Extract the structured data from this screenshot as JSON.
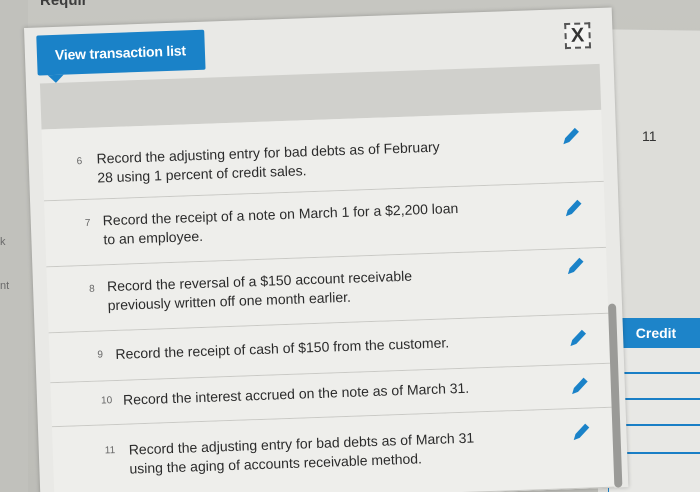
{
  "background": {
    "heading_fragment": "Requir",
    "left_fragments": [
      "k",
      "nt"
    ],
    "right_panel": {
      "number": "11",
      "credit_label": "Credit"
    }
  },
  "modal": {
    "title": "View transaction list",
    "close_label": "X",
    "transactions": [
      {
        "number": "6",
        "text": [
          "Record the adjusting entry for bad debts as of February",
          "28 using 1 percent of credit sales."
        ]
      },
      {
        "number": "7",
        "text": [
          "Record the receipt of a note on March 1 for a $2,200 loan",
          "to an employee."
        ]
      },
      {
        "number": "8",
        "text": [
          "Record the reversal of a $150 account receivable",
          "previously written off one month earlier."
        ]
      },
      {
        "number": "9",
        "text": [
          "Record the receipt of cash of $150 from the customer."
        ]
      },
      {
        "number": "10",
        "text": [
          "Record the interest accrued on the note as of March 31."
        ]
      },
      {
        "number": "11",
        "text": [
          "Record the adjusting entry for bad debts as of March 31",
          "using the aging of accounts receivable method."
        ]
      }
    ],
    "edit_icon": "pencil-icon",
    "colors": {
      "accent": "#1a82c8",
      "edit_icon": "#1a82c8"
    }
  }
}
